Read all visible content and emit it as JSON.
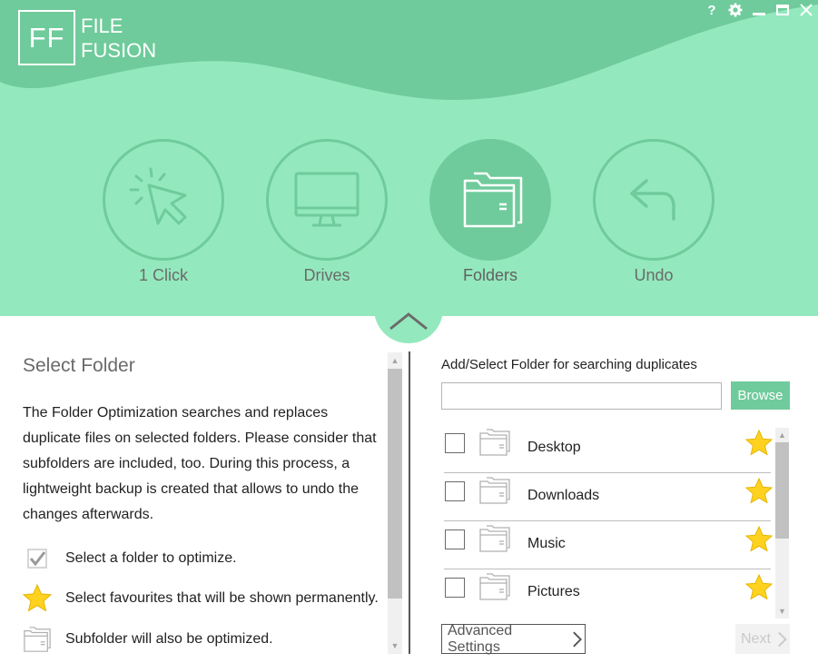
{
  "app": {
    "logo_abbr": "FF",
    "logo_line1": "FILE",
    "logo_line2": "FUSION"
  },
  "window_controls": [
    "help-icon",
    "gear-icon",
    "minimize-icon",
    "maximize-icon",
    "close-icon"
  ],
  "colors": {
    "header_bg": "#93e9bd",
    "wave": "#6fcb9b",
    "accent": "#6fcb9b",
    "star": "#ffd21f"
  },
  "modes": [
    {
      "label": "1 Click",
      "icon": "cursor-click-icon",
      "active": false
    },
    {
      "label": "Drives",
      "icon": "monitor-icon",
      "active": false
    },
    {
      "label": "Folders",
      "icon": "folders-icon",
      "active": true
    },
    {
      "label": "Undo",
      "icon": "undo-arrow-icon",
      "active": false
    }
  ],
  "left": {
    "title": "Select Folder",
    "description": "The Folder Optimization searches and replaces duplicate files on selected folders. Please consider that subfolders are included, too. During this process, a lightweight backup is created that allows to undo the changes afterwards.",
    "legend": [
      {
        "icon": "checkmark-icon",
        "text": "Select a folder to optimize."
      },
      {
        "icon": "star-icon",
        "text": "Select favourites that will be shown permanently."
      },
      {
        "icon": "folder-icon",
        "text": "Subfolder will also be optimized."
      }
    ]
  },
  "right": {
    "label": "Add/Select Folder for searching duplicates",
    "input_value": "",
    "browse": "Browse",
    "folders": [
      {
        "name": "Desktop",
        "checked": false,
        "favourite": true
      },
      {
        "name": "Downloads",
        "checked": false,
        "favourite": true
      },
      {
        "name": "Music",
        "checked": false,
        "favourite": true
      },
      {
        "name": "Pictures",
        "checked": false,
        "favourite": true
      }
    ],
    "advanced": "Advanced Settings",
    "next": "Next"
  }
}
